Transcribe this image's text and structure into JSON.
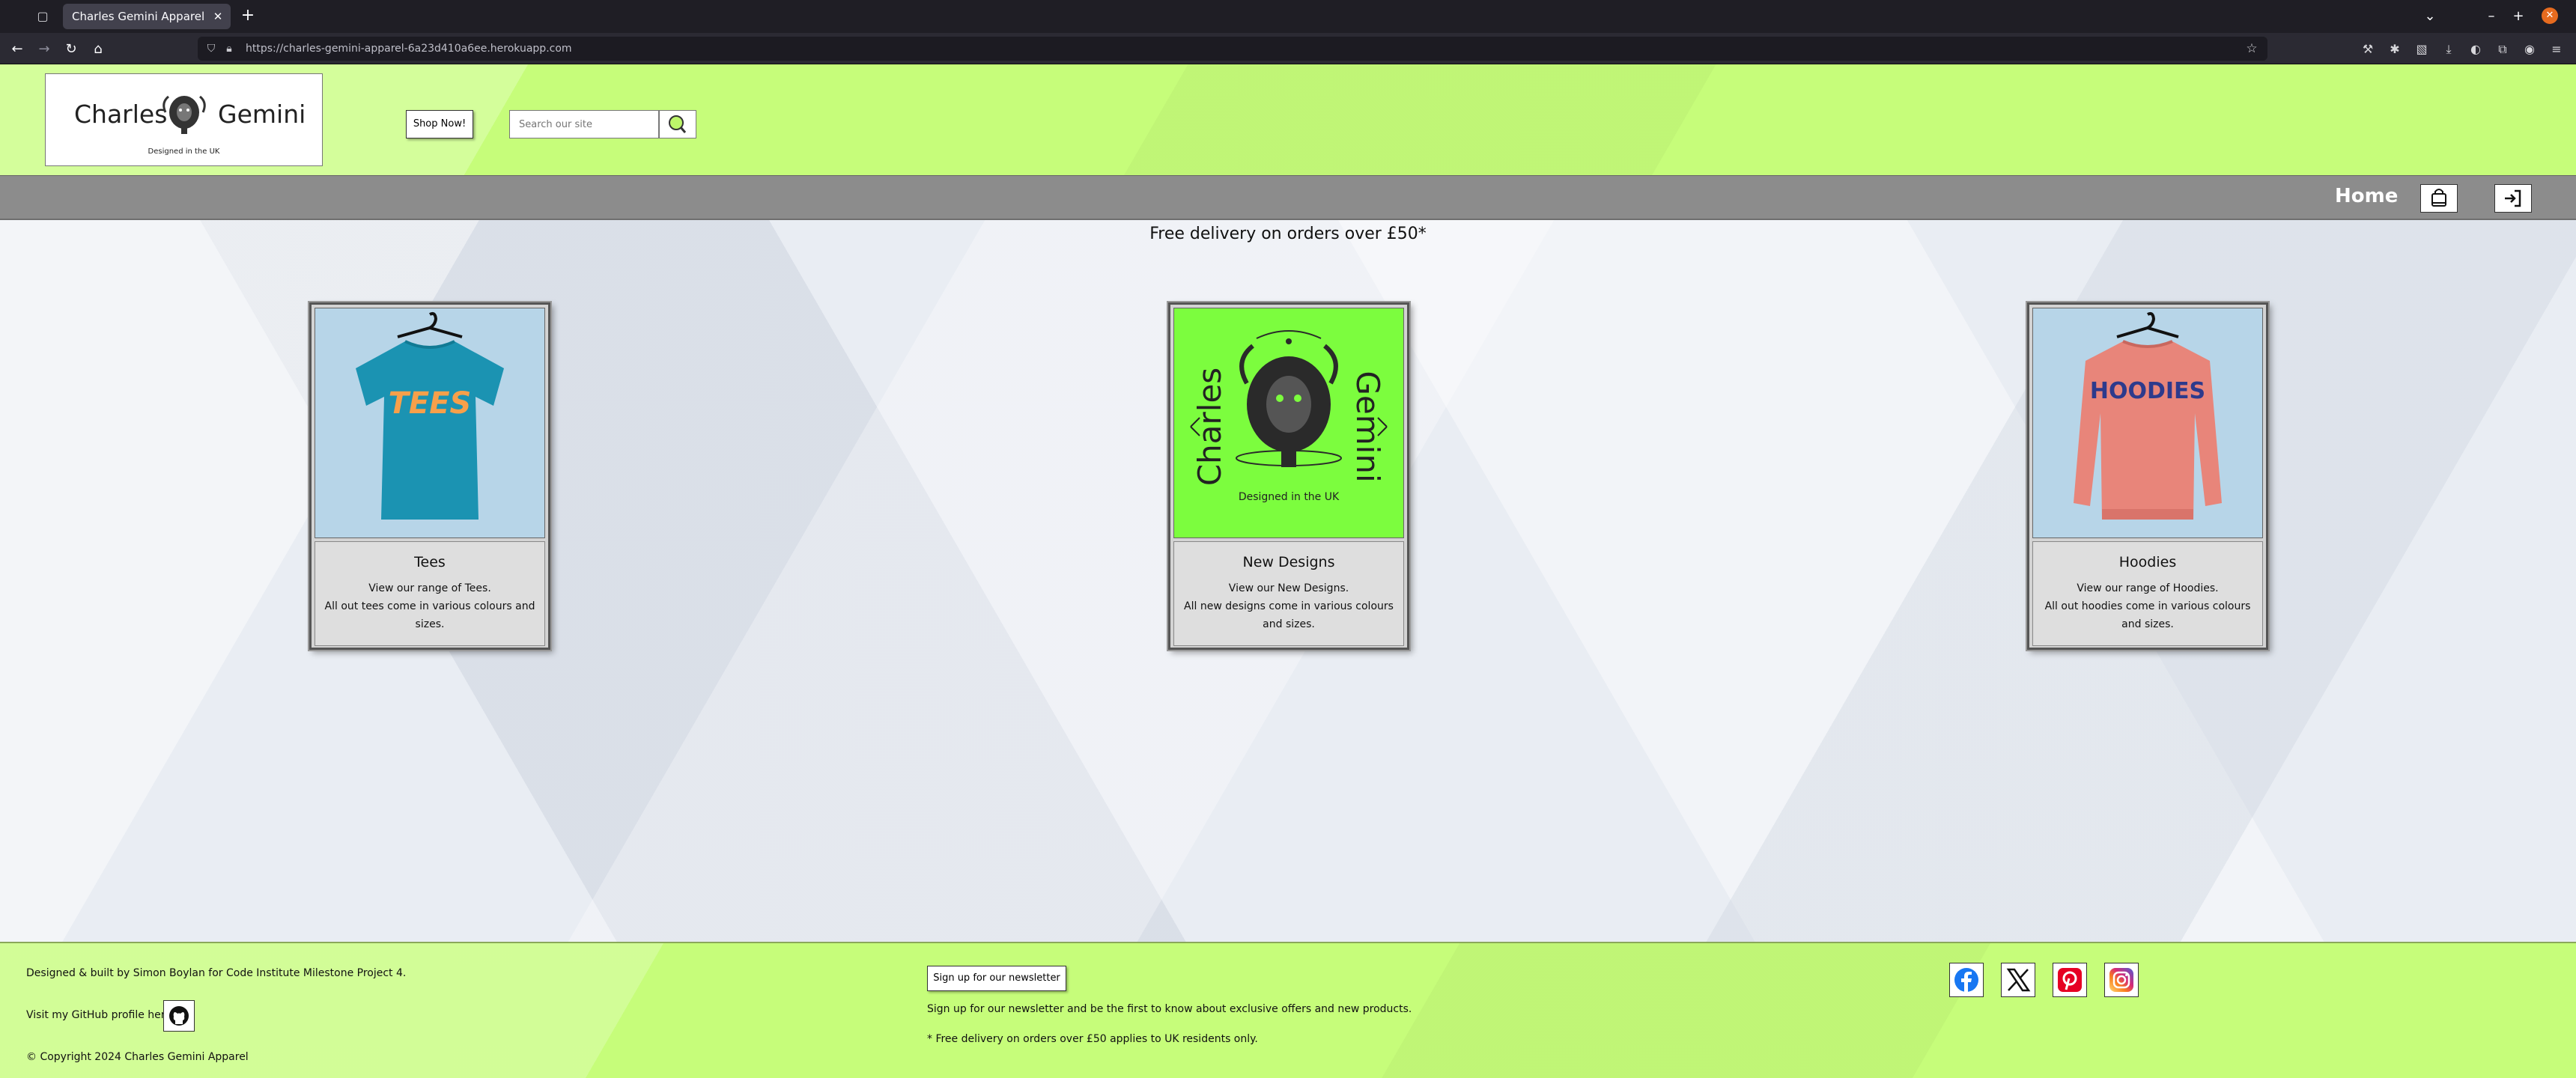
{
  "browser": {
    "tab_title": "Charles Gemini Apparel",
    "url": "https://charles-gemini-apparel-6a23d410a6ee.herokuapp.com"
  },
  "header": {
    "logo_left": "Charles",
    "logo_right": "Gemini",
    "logo_tagline": "Designed in the UK",
    "shop_button": "Shop Now!",
    "search_placeholder": "Search our site"
  },
  "menu": {
    "home": "Home"
  },
  "banner": "Free delivery on orders over £50*",
  "cards": [
    {
      "title": "Tees",
      "line1": "View our range of Tees.",
      "line2": "All out tees come in various colours and sizes.",
      "image_text": "TEES",
      "bg": "#b7d5e8",
      "garment": "#1b93b2"
    },
    {
      "title": "New Designs",
      "line1": "View our New Designs.",
      "line2": "All new designs come in various colours and sizes.",
      "image_left": "Charles",
      "image_right": "Gemini",
      "image_tagline": "Designed in the UK",
      "bg": "#7cfd3e"
    },
    {
      "title": "Hoodies",
      "line1": "View our range of Hoodies.",
      "line2": "All out hoodies come in various colours and sizes.",
      "image_text": "HOODIES",
      "bg": "#b7d5e8",
      "garment": "#e8857a"
    }
  ],
  "footer": {
    "credit": "Designed & built by Simon Boylan for Code Institute Milestone Project 4.",
    "github_label": "Visit my GitHub profile here:",
    "copyright": "© Copyright 2024 Charles Gemini Apparel",
    "newsletter_button": "Sign up for our newsletter",
    "newsletter_text": "Sign up for our newsletter and be the first to know about exclusive offers and new products.",
    "delivery_note": "* Free delivery on orders over £50 applies to UK residents only."
  },
  "colors": {
    "accent": "#c6fd7a",
    "menubar": "#8c8c8c",
    "facebook": "#1877f2",
    "pinterest": "#e60023"
  }
}
